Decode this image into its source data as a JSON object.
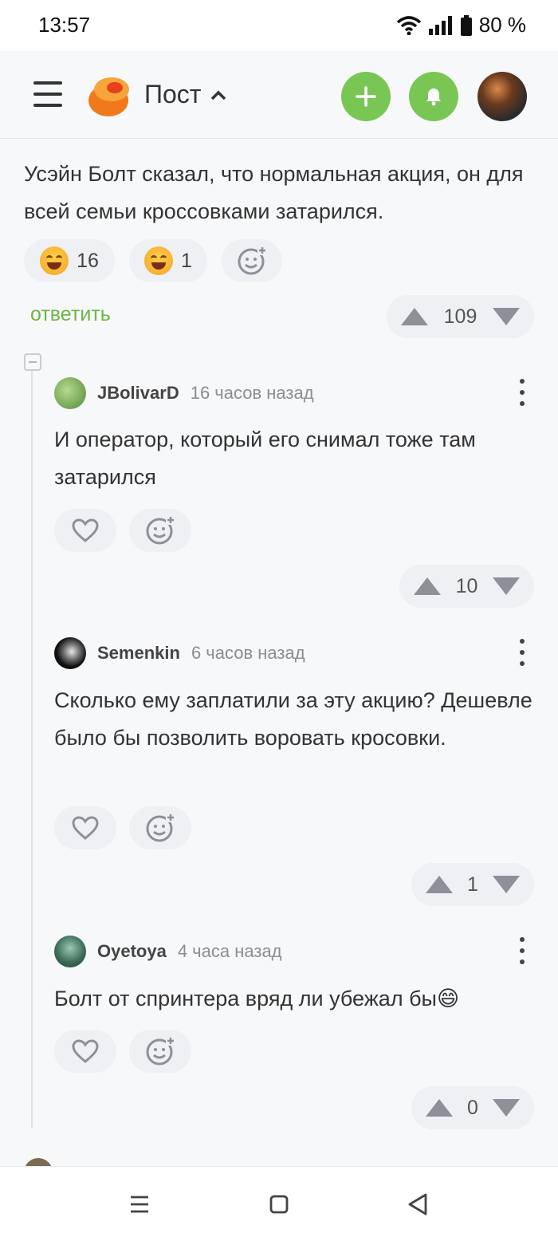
{
  "status_bar": {
    "time": "13:57",
    "battery": "80 %"
  },
  "header": {
    "title": "Пост",
    "add_icon": "plus-icon",
    "bell_icon": "bell-icon"
  },
  "post": {
    "text": "Усэйн Болт сказал, что нормальная акция, он для всей семьи кроссовками затарился.",
    "reactions": [
      {
        "emoji": "laughing-face",
        "count": "16"
      },
      {
        "emoji": "smiling-face",
        "count": "1"
      }
    ],
    "reply_label": "ответить",
    "votes": "109"
  },
  "comments": [
    {
      "user": "JBolivarD",
      "time": "16 часов назад",
      "text": "И оператор, который его снимал тоже там затарился",
      "votes": "10",
      "avatar_color": "#6aa84f"
    },
    {
      "user": "Semenkin",
      "time": "6 часов назад",
      "text": "Сколько ему заплатили за эту акцию? Дешевле было бы позволить воровать кросовки.",
      "votes": "1",
      "avatar_color": "#222222"
    },
    {
      "user": "Oyetoya",
      "time": "4 часа назад",
      "text": "Болт от спринтера вряд ли убежал бы😄",
      "votes": "0",
      "avatar_color": "#3f6f5a"
    }
  ],
  "colors": {
    "accent": "#7ac655",
    "link": "#6cb645",
    "logo": "#f07a1a"
  }
}
